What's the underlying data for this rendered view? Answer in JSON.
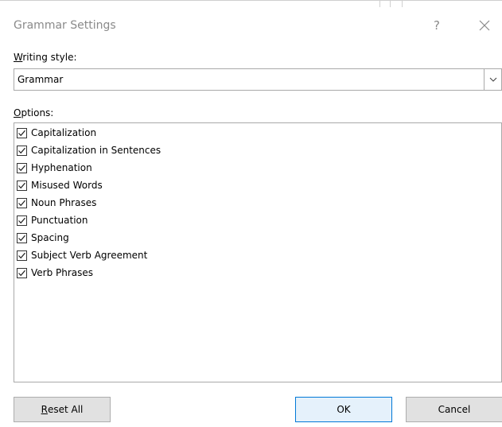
{
  "window": {
    "title": "Grammar Settings",
    "help_label": "?"
  },
  "writing_style": {
    "label_accel": "W",
    "label_rest": "riting style:",
    "selected": "Grammar"
  },
  "options": {
    "label_accel": "O",
    "label_rest": "ptions:",
    "items": [
      {
        "label": "Capitalization",
        "checked": true
      },
      {
        "label": "Capitalization in Sentences",
        "checked": true
      },
      {
        "label": "Hyphenation",
        "checked": true
      },
      {
        "label": "Misused Words",
        "checked": true
      },
      {
        "label": "Noun Phrases",
        "checked": true
      },
      {
        "label": "Punctuation",
        "checked": true
      },
      {
        "label": "Spacing",
        "checked": true
      },
      {
        "label": "Subject Verb Agreement",
        "checked": true
      },
      {
        "label": "Verb Phrases",
        "checked": true
      }
    ]
  },
  "buttons": {
    "reset_accel": "R",
    "reset_rest": "eset All",
    "ok": "OK",
    "cancel": "Cancel"
  },
  "colors": {
    "default_button_border": "#0078d7",
    "title_text": "#8a8a8a"
  }
}
